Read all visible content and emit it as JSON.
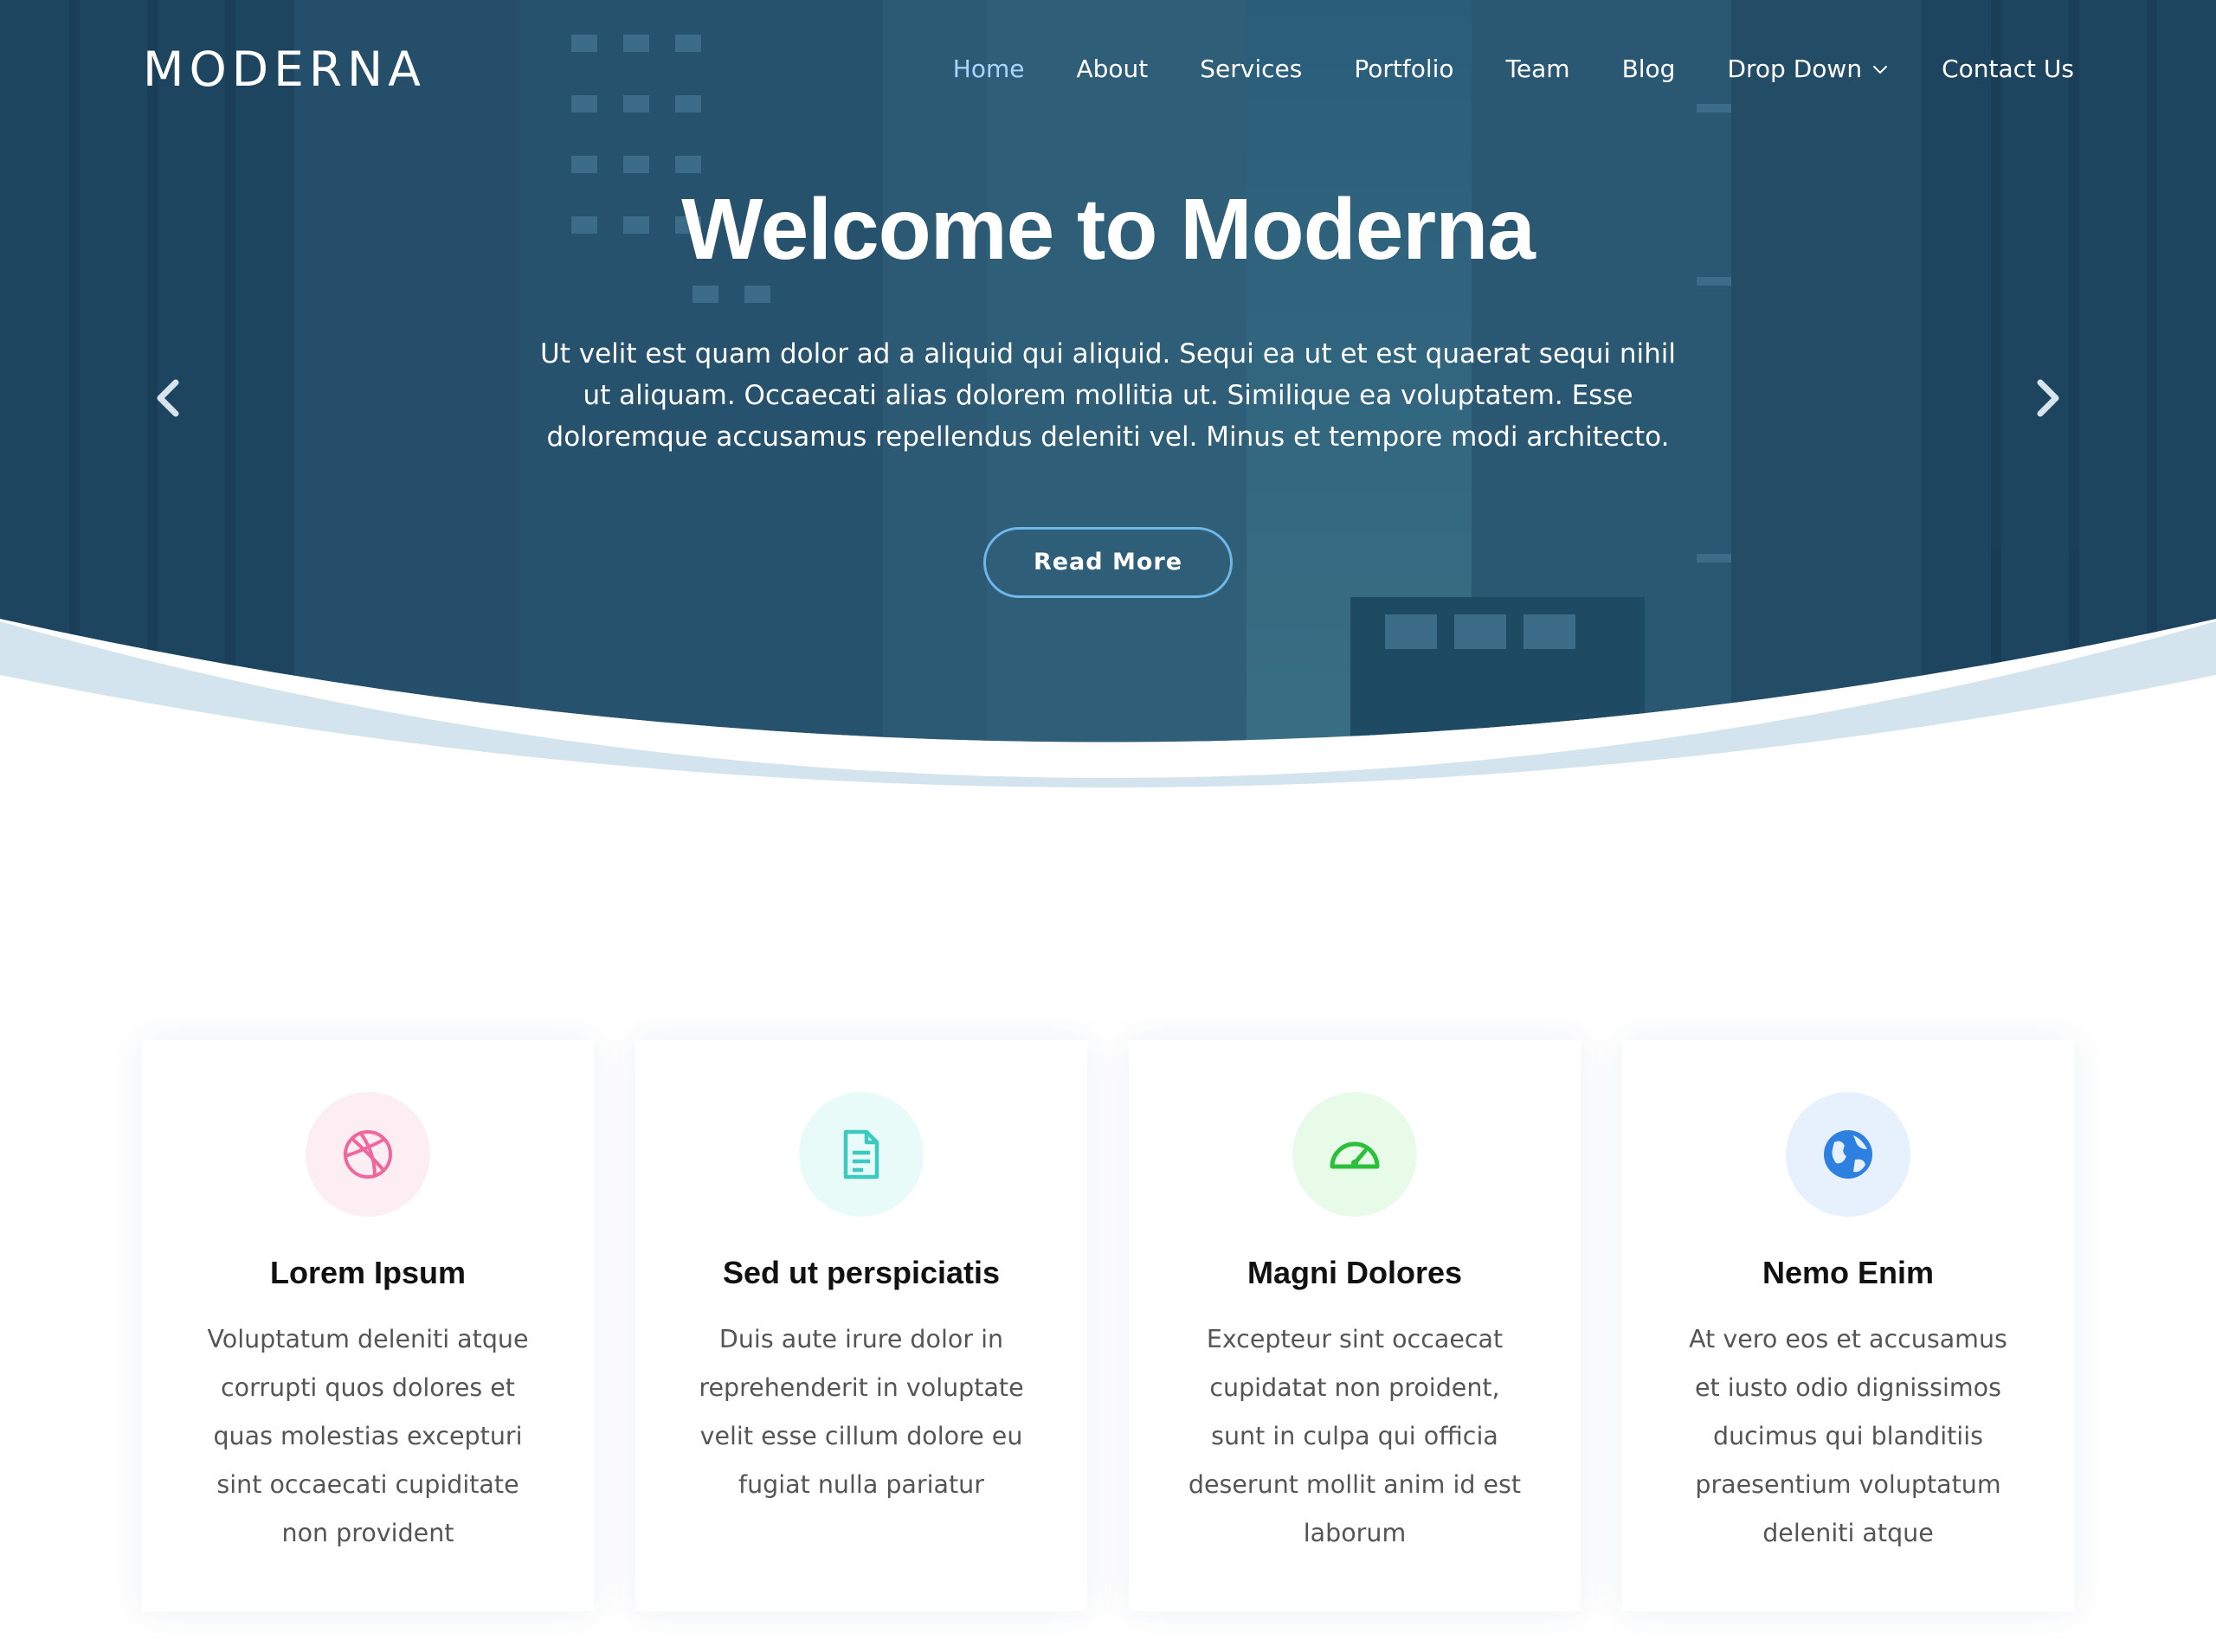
{
  "header": {
    "logo": "MODERNA",
    "nav": [
      {
        "label": "Home",
        "active": true
      },
      {
        "label": "About"
      },
      {
        "label": "Services"
      },
      {
        "label": "Portfolio"
      },
      {
        "label": "Team"
      },
      {
        "label": "Blog"
      },
      {
        "label": "Drop Down",
        "icon": "chevron-down-icon"
      },
      {
        "label": "Contact Us"
      }
    ]
  },
  "hero": {
    "title": "Welcome to Moderna",
    "description": "Ut velit est quam dolor ad a aliquid qui aliquid. Sequi ea ut et est quaerat sequi nihil ut aliquam. Occaecati alias dolorem mollitia ut. Similique ea voluptatem. Esse doloremque accusamus repellendus deleniti vel. Minus et tempore modi architecto.",
    "button": "Read More",
    "prev_icon": "chevron-left-icon",
    "next_icon": "chevron-right-icon"
  },
  "features": [
    {
      "icon": "dribbble-icon",
      "color": "#f0679e",
      "bg": "#fdeef3",
      "title": "Lorem Ipsum",
      "text": "Voluptatum deleniti atque corrupti quos dolores et quas molestias excepturi sint occaecati cupiditate non provident"
    },
    {
      "icon": "file-text-icon",
      "color": "#3bc9c0",
      "bg": "#e8fbf9",
      "title": "Sed ut perspiciatis",
      "text": "Duis aute irure dolor in reprehenderit in voluptate velit esse cillum dolore eu fugiat nulla pariatur"
    },
    {
      "icon": "speedometer-icon",
      "color": "#2cbf3a",
      "bg": "#e8fbe9",
      "title": "Magni Dolores",
      "text": "Excepteur sint occaecat cupidatat non proident, sunt in culpa qui officia deserunt mollit anim id est laborum"
    },
    {
      "icon": "globe-icon",
      "color": "#2d7fe0",
      "bg": "#e6f1fd",
      "title": "Nemo Enim",
      "text": "At vero eos et accusamus et iusto odio dignissimos ducimus qui blanditiis praesentium voluptatum deleniti atque"
    }
  ]
}
